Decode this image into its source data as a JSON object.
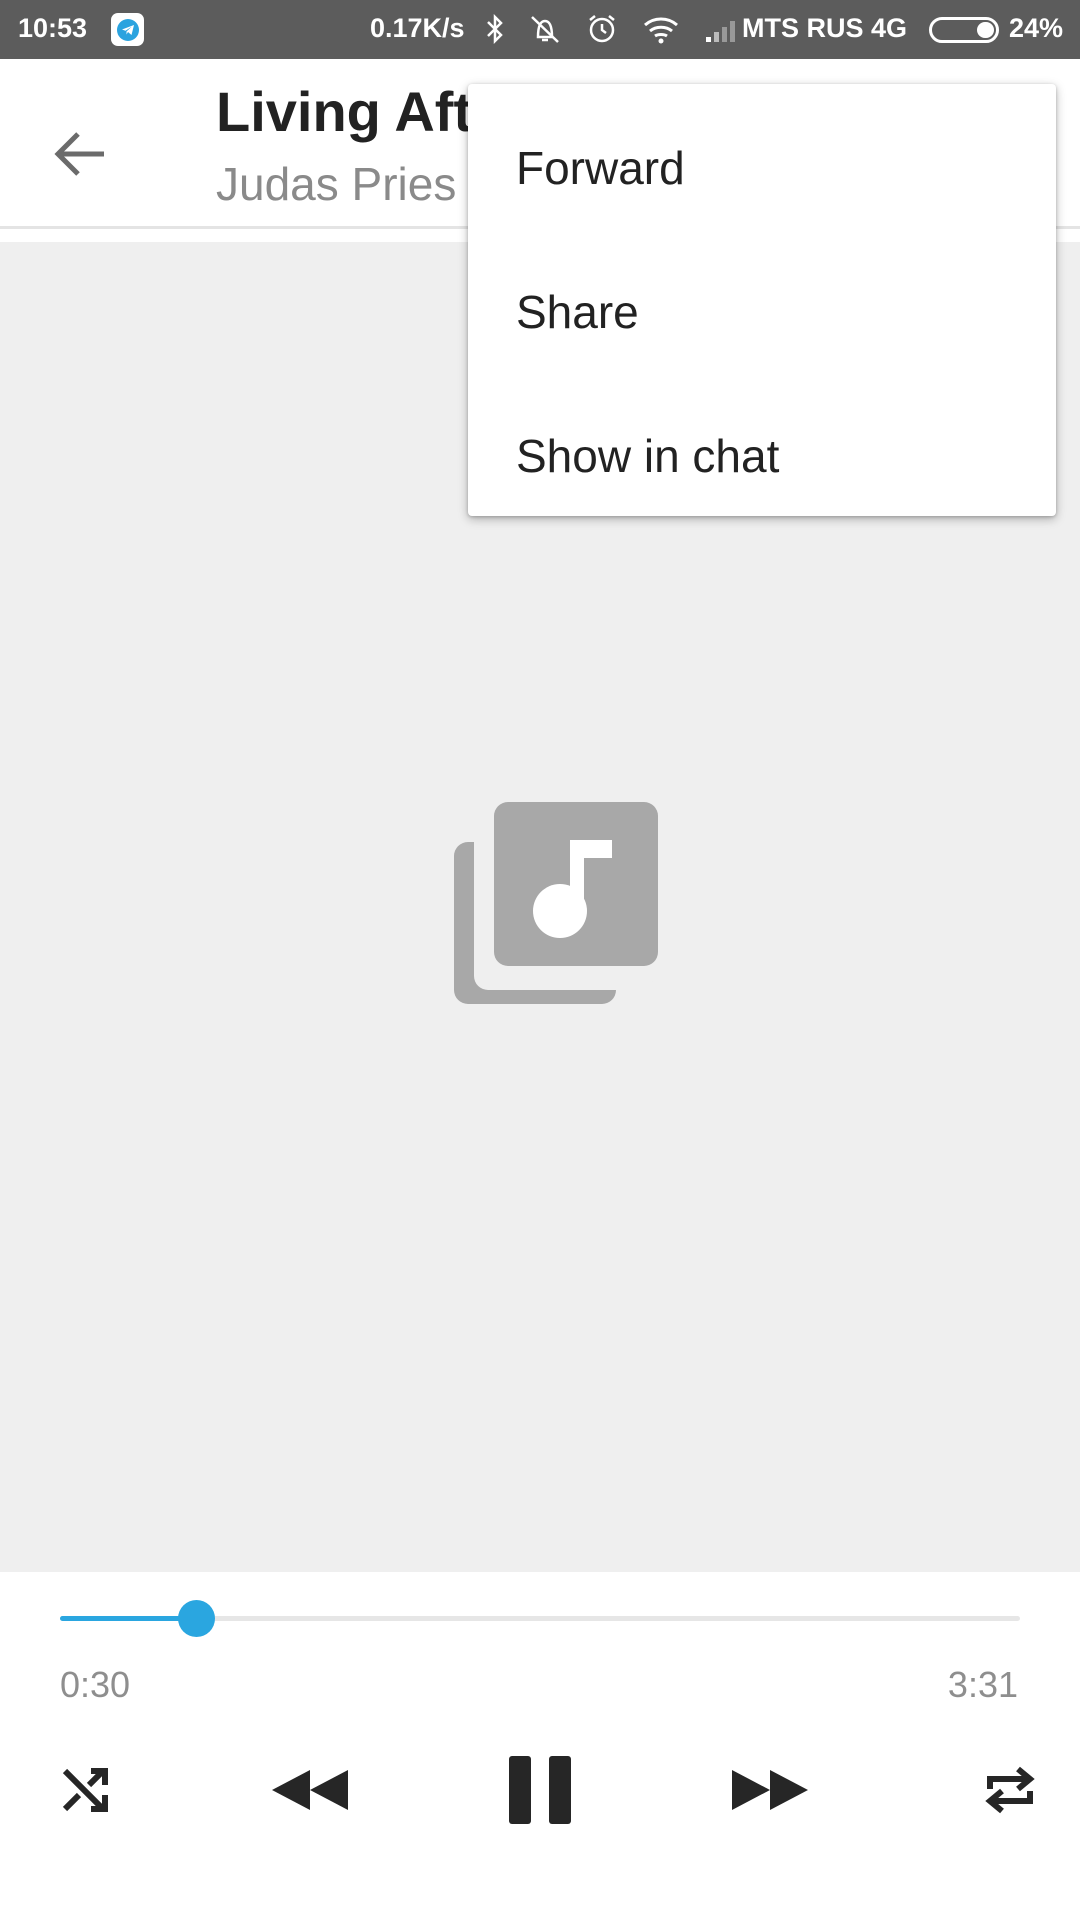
{
  "status_bar": {
    "time": "10:53",
    "speed": "0.17K/s",
    "carrier": "MTS RUS 4G",
    "battery_pct": "24%",
    "icons": [
      "telegram-icon",
      "bluetooth-icon",
      "vibrate-off-icon",
      "alarm-icon",
      "wifi-icon",
      "signal-icon",
      "battery-icon"
    ]
  },
  "header": {
    "title": "Living Aft",
    "subtitle": "Judas Pries"
  },
  "menu": {
    "items": [
      {
        "label": "Forward"
      },
      {
        "label": "Share"
      },
      {
        "label": "Show in chat"
      }
    ]
  },
  "player": {
    "current_time": "0:30",
    "total_time": "3:31",
    "progress": 0.142,
    "accent_color": "#2aa6e0",
    "controls": [
      "shuffle-icon",
      "rewind-icon",
      "pause-icon",
      "fast-forward-icon",
      "repeat-icon"
    ]
  }
}
